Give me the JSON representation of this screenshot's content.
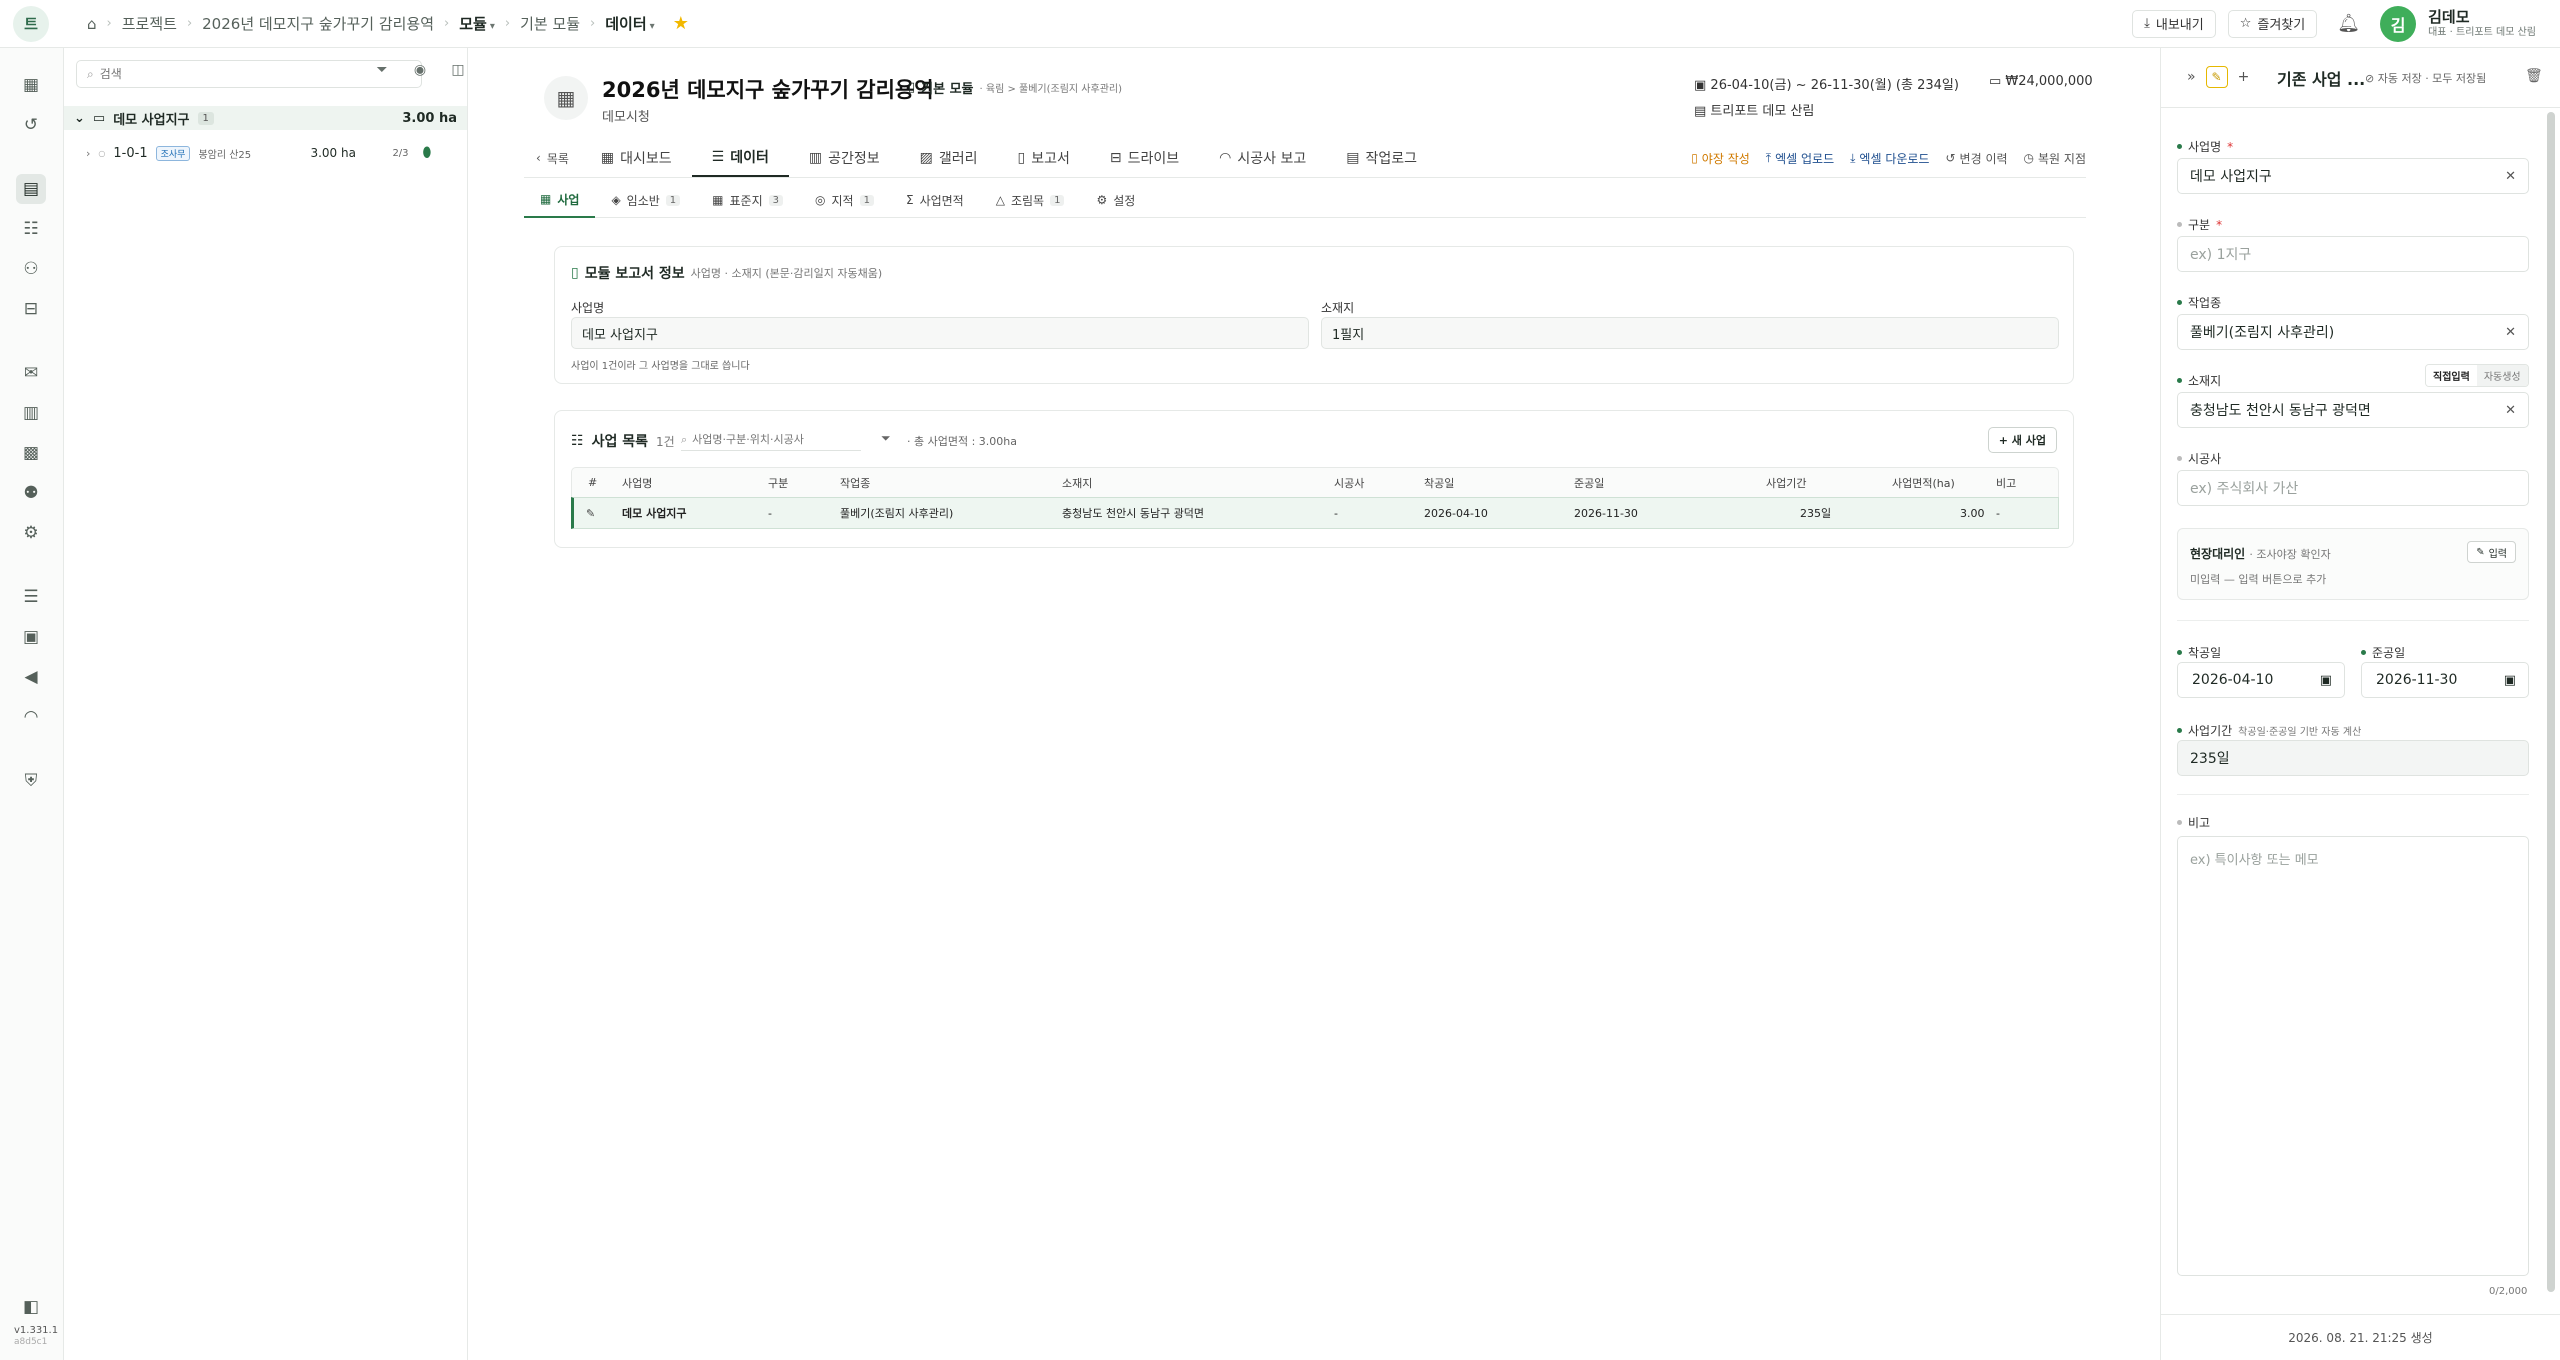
{
  "topbar": {
    "logo": "트",
    "breadcrumbs": [
      "프로젝트",
      "2026년 데모지구 숲가꾸기 감리용역",
      "모듈",
      "기본 모듈",
      "데이터"
    ],
    "export_label": "내보내기",
    "favorite_label": "즐겨찾기",
    "user": {
      "initial": "김",
      "name": "김데모",
      "role": "대표 · 트리포트 데모 산림"
    }
  },
  "rail": {
    "version": "v1.331.1",
    "hash": "a8d5c1"
  },
  "tree": {
    "search_placeholder": "검색",
    "group": {
      "name": "데모 사업지구",
      "count": "1",
      "area": "3.00 ha"
    },
    "items": [
      {
        "code": "1-0-1",
        "tag": "조사무",
        "location": "봉암리 산25",
        "area": "3.00 ha",
        "progress": "2/3"
      }
    ]
  },
  "project": {
    "title": "2026년 데모지구 숲가꾸기 감리용역",
    "module": "기본 모듈",
    "module_sub": "· 육림 > 풀베기(조림지 사후관리)",
    "org": "데모시청",
    "period": "26-04-10(금) ~ 26-11-30(월) (총 234일)",
    "budget": "₩24,000,000",
    "company": "트리포트 데모 산림"
  },
  "tabs": {
    "back": "목록",
    "items": [
      "대시보드",
      "데이터",
      "공간정보",
      "갤러리",
      "보고서",
      "드라이브",
      "시공사 보고",
      "작업로그"
    ],
    "active": 1,
    "actions": [
      "야장 작성",
      "엑셀 업로드",
      "엑셀 다운로드",
      "변경 이력",
      "복원 지점"
    ]
  },
  "subtabs": {
    "items": [
      {
        "label": "사업",
        "count": ""
      },
      {
        "label": "임소반",
        "count": "1"
      },
      {
        "label": "표준지",
        "count": "3"
      },
      {
        "label": "지적",
        "count": "1"
      },
      {
        "label": "사업면적",
        "count": ""
      },
      {
        "label": "조림목",
        "count": "1"
      },
      {
        "label": "설정",
        "count": ""
      }
    ]
  },
  "report_info": {
    "title": "모듈 보고서 정보",
    "subtitle": "사업명 · 소재지 (본문·감리일지 자동채움)",
    "name_label": "사업명",
    "name_value": "데모 사업지구",
    "loc_label": "소재지",
    "loc_value": "1필지",
    "hint": "사업이 1건이라 그 사업명을 그대로 씁니다"
  },
  "list": {
    "title": "사업 목록",
    "count": "1건",
    "search_placeholder": "사업명·구분·위치·시공사",
    "summary": "· 총 사업면적 : 3.00ha",
    "new_label": "+ 새 사업",
    "columns": [
      "#",
      "사업명",
      "구분",
      "작업종",
      "소재지",
      "시공사",
      "착공일",
      "준공일",
      "사업기간",
      "사업면적(ha)",
      "비고"
    ],
    "rows": [
      {
        "name": "데모 사업지구",
        "kind": "-",
        "work": "풀베기(조림지 사후관리)",
        "location": "충청남도 천안시 동남구 광덕면",
        "contractor": "-",
        "start": "2026-04-10",
        "end": "2026-11-30",
        "period": "235일",
        "area": "3.00",
        "note": "-"
      }
    ]
  },
  "panel": {
    "title": "기존 사업 ...",
    "save_status": "자동 저장 · 모두 저장됨",
    "name_label": "사업명",
    "name_value": "데모 사업지구",
    "kind_label": "구분",
    "kind_placeholder": "ex) 1지구",
    "work_label": "작업종",
    "work_value": "풀베기(조림지 사후관리)",
    "loc_label": "소재지",
    "loc_toggle": [
      "직접입력",
      "자동생성"
    ],
    "loc_value": "충청남도 천안시 동남구 광덕면",
    "contractor_label": "시공사",
    "contractor_placeholder": "ex) 주식회사 가산",
    "site_title": "현장대리인",
    "site_sub": "· 조사야장 확인자",
    "site_btn": "입력",
    "site_empty": "미입력 — 입력 버튼으로 추가",
    "start_label": "착공일",
    "start_value": "2026-04-10",
    "end_label": "준공일",
    "end_value": "2026-11-30",
    "period_label": "사업기간",
    "period_hint": "착공일·준공일 기반 자동 계산",
    "period_value": "235일",
    "note_label": "비고",
    "note_placeholder": "ex) 특이사항 또는 메모",
    "note_count": "0/2,000",
    "footer": "2026. 08. 21. 21:25 생성"
  },
  "colors": {
    "accent": "#2a7a4a",
    "star": "#f2b800",
    "avatar": "#3fae5a"
  }
}
